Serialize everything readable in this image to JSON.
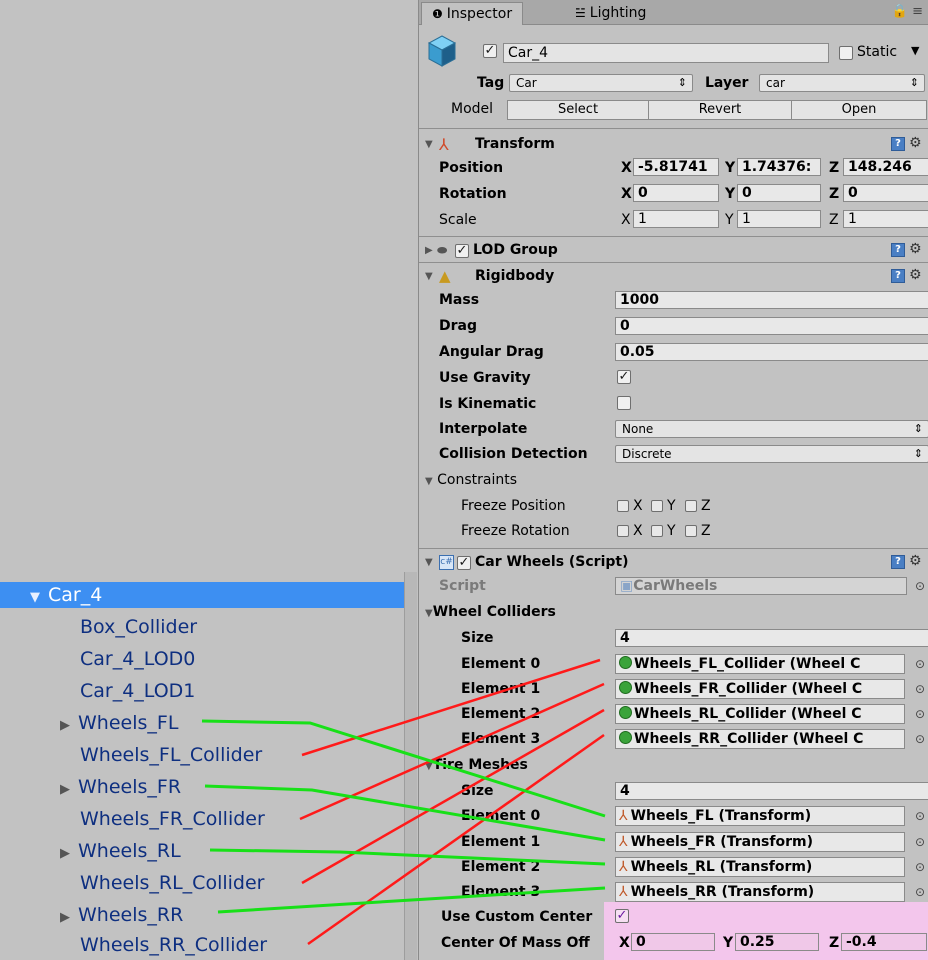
{
  "hierarchy": {
    "items": [
      {
        "label": "Car_4",
        "arrow": "▼",
        "selected": true
      },
      {
        "label": "Box_Collider",
        "arrow": ""
      },
      {
        "label": "Car_4_LOD0",
        "arrow": ""
      },
      {
        "label": "Car_4_LOD1",
        "arrow": ""
      },
      {
        "label": "Wheels_FL",
        "arrow": "▶"
      },
      {
        "label": "Wheels_FL_Collider",
        "arrow": ""
      },
      {
        "label": "Wheels_FR",
        "arrow": "▶"
      },
      {
        "label": "Wheels_FR_Collider",
        "arrow": ""
      },
      {
        "label": "Wheels_RL",
        "arrow": "▶"
      },
      {
        "label": "Wheels_RL_Collider",
        "arrow": ""
      },
      {
        "label": "Wheels_RR",
        "arrow": "▶"
      },
      {
        "label": "Wheels_RR_Collider",
        "arrow": ""
      }
    ]
  },
  "tabs": {
    "inspector": "Inspector",
    "lighting": "Lighting"
  },
  "object": {
    "name": "Car_4",
    "static_label": "Static",
    "tag_label": "Tag",
    "tag_value": "Car",
    "layer_label": "Layer",
    "layer_value": "car",
    "model_label": "Model",
    "select": "Select",
    "revert": "Revert",
    "open": "Open"
  },
  "transform": {
    "title": "Transform",
    "position_label": "Position",
    "rotation_label": "Rotation",
    "scale_label": "Scale",
    "position": {
      "x": "-5.81741",
      "y": "1.74376:",
      "z": "148.246"
    },
    "rotation": {
      "x": "0",
      "y": "0",
      "z": "0"
    },
    "scale": {
      "x": "1",
      "y": "1",
      "z": "1"
    }
  },
  "lod": {
    "title": "LOD Group"
  },
  "rigidbody": {
    "title": "Rigidbody",
    "mass_label": "Mass",
    "mass": "1000",
    "drag_label": "Drag",
    "drag": "0",
    "angular_drag_label": "Angular Drag",
    "angular_drag": "0.05",
    "use_gravity_label": "Use Gravity",
    "is_kinematic_label": "Is Kinematic",
    "interpolate_label": "Interpolate",
    "interpolate": "None",
    "collision_label": "Collision Detection",
    "collision": "Discrete",
    "constraints_label": "Constraints",
    "freeze_position_label": "Freeze Position",
    "freeze_rotation_label": "Freeze Rotation",
    "x": "X",
    "y": "Y",
    "z": "Z"
  },
  "carwheels": {
    "title": "Car Wheels (Script)",
    "script_label": "Script",
    "script_value": "CarWheels",
    "colliders_label": "Wheel Colliders",
    "size_label": "Size",
    "colliders_size": "4",
    "elements": [
      "Element 0",
      "Element 1",
      "Element 2",
      "Element 3"
    ],
    "colliders": [
      "Wheels_FL_Collider (Wheel C",
      "Wheels_FR_Collider (Wheel C",
      "Wheels_RL_Collider (Wheel C",
      "Wheels_RR_Collider (Wheel C"
    ],
    "tires_label": "Tire Meshes",
    "tires_size": "4",
    "tires": [
      "Wheels_FL (Transform)",
      "Wheels_FR (Transform)",
      "Wheels_RL (Transform)",
      "Wheels_RR (Transform)"
    ],
    "use_custom_center_label": "Use Custom Center",
    "center_label": "Center Of Mass Off",
    "center": {
      "x": "0",
      "y": "0.25",
      "z": "-0.4"
    }
  },
  "colors": {
    "collider_link": "#ff1a1a",
    "mesh_link": "#18e018",
    "selection": "#3d8ff2",
    "highlight": "#f3c6ec"
  }
}
